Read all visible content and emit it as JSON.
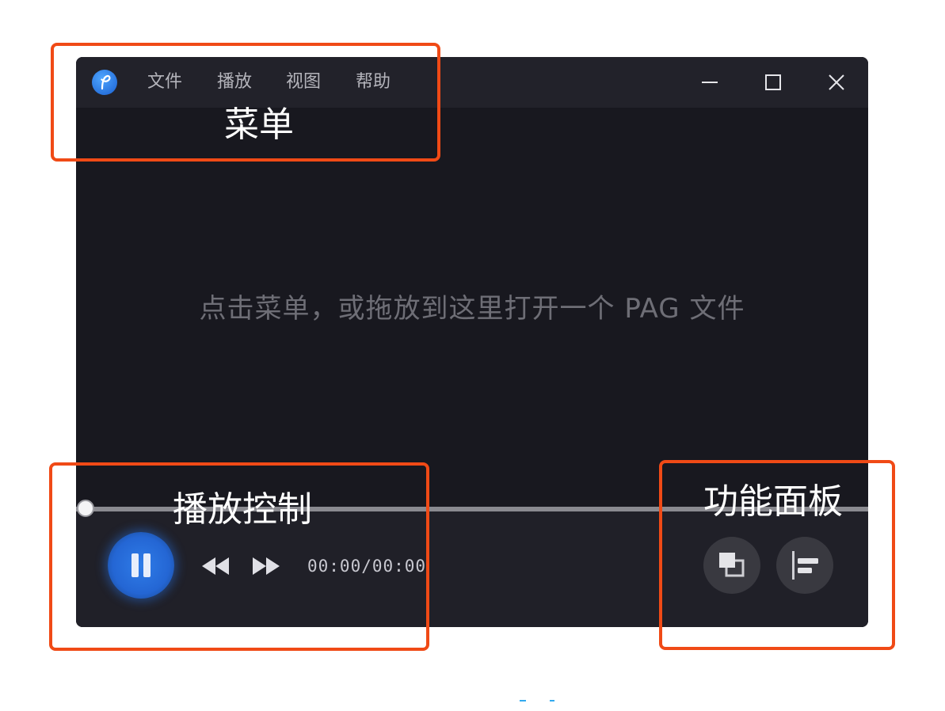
{
  "menu": {
    "items": [
      {
        "label": "文件"
      },
      {
        "label": "播放"
      },
      {
        "label": "视图"
      },
      {
        "label": "帮助"
      }
    ]
  },
  "content": {
    "hint": "点击菜单，或拖放到这里打开一个 PAG 文件"
  },
  "player": {
    "timecode": "00:00/00:00",
    "progress": 0,
    "state": "playing"
  },
  "annotations": {
    "menu_label": "菜单",
    "controls_label": "播放控制",
    "panel_label": "功能面板",
    "color": "#f04a16"
  },
  "colors": {
    "window_bg": "#18181f",
    "titlebar_bg": "#22222a",
    "accent": "#2466d4"
  },
  "icons": {
    "logo": "pag-logo-icon",
    "minimize": "minimize-icon",
    "maximize": "maximize-icon",
    "close": "close-icon",
    "pause": "pause-icon",
    "rewind": "rewind-icon",
    "fast_forward": "fast-forward-icon",
    "layers": "layers-icon",
    "align": "align-left-icon"
  }
}
